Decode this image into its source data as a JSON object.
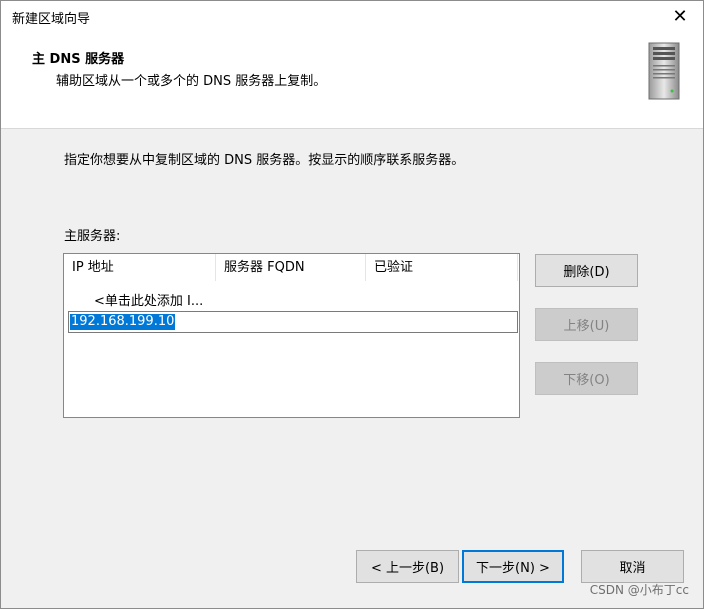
{
  "window": {
    "title": "新建区域向导",
    "close_label": "✕"
  },
  "header": {
    "title": "主 DNS 服务器",
    "subtitle": "辅助区域从一个或多个的 DNS 服务器上复制。",
    "icon": "server-icon"
  },
  "body": {
    "instruction": "指定你想要从中复制区域的 DNS 服务器。按显示的顺序联系服务器。",
    "primary_label": "主服务器:"
  },
  "list": {
    "columns": [
      "IP 地址",
      "服务器 FQDN",
      "已验证"
    ],
    "add_row": "<单击此处添加 I...",
    "edit_value": "192.168.199.10"
  },
  "side_buttons": {
    "delete": "删除(D)",
    "up": "上移(U)",
    "down": "下移(O)"
  },
  "footer": {
    "back": "< 上一步(B)",
    "next": "下一步(N) >",
    "cancel": "取消"
  },
  "watermark": "CSDN @小布丁cc",
  "colors": {
    "accent": "#0078d7",
    "window_bg": "#f0f0f0"
  }
}
